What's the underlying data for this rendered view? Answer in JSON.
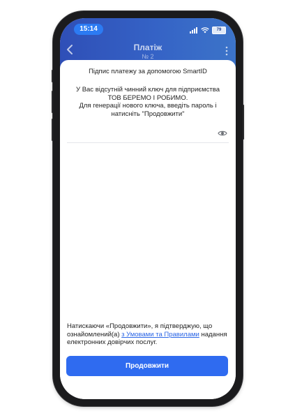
{
  "status_bar": {
    "time": "15:14",
    "battery": "79"
  },
  "navbar": {
    "title": "Платіж",
    "subtitle": "№ 2"
  },
  "sheet": {
    "title": "Підпис платежу за допомогою SmartID",
    "message_line1": "У Вас відсутній чинний ключ для підприємства",
    "message_line2": "ТОВ БЕРЕМО І РОБИМО.",
    "message_line3": "Для генерації нового ключа, введіть пароль і",
    "message_line4": "натисніть \"Продовжити\"",
    "password": {
      "value": "",
      "placeholder": ""
    },
    "consent_text_before": "Натискаючи «Продовжити», я підтверджую, що ознайомлений(а) ",
    "consent_link": "з Умовами та Правилами",
    "consent_text_after": " надання електронних довірчих послуг.",
    "continue_label": "Продовжити"
  },
  "colors": {
    "accent": "#2f6bf0",
    "header_gradient_start": "#2f4fb7",
    "header_gradient_end": "#3c74c9",
    "time_pill": "#2c7bf3"
  },
  "icons": [
    "back-chevron-icon",
    "kebab-menu-icon",
    "eye-icon",
    "signal-icon",
    "wifi-icon",
    "battery-icon"
  ]
}
